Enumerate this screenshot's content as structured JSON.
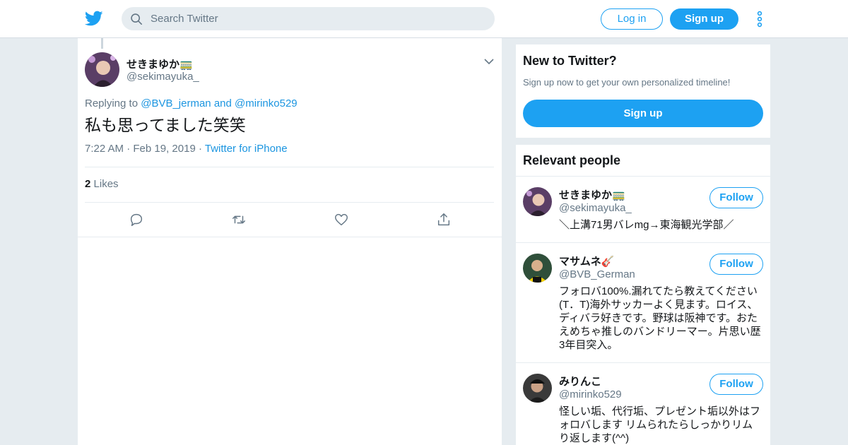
{
  "header": {
    "search_placeholder": "Search Twitter",
    "login_label": "Log in",
    "signup_label": "Sign up"
  },
  "tweet": {
    "author_name": "せきまゆか🚃",
    "author_handle": "@sekimayuka_",
    "replying_prefix": "Replying to",
    "reply_user_1": "@BVB_jerman",
    "reply_and": "and",
    "reply_user_2": "@mirinko529",
    "text": "私も思ってました笑笑",
    "time": "7:22 AM",
    "date": "Feb 19, 2019",
    "source": "Twitter for iPhone",
    "likes_count": "2",
    "likes_label": "Likes"
  },
  "sidebar": {
    "new_title": "New to Twitter?",
    "new_sub": "Sign up now to get your own personalized timeline!",
    "new_signup": "Sign up",
    "relevant_title": "Relevant people",
    "people": [
      {
        "name": "せきまゆか🚃",
        "handle": "@sekimayuka_",
        "follow": "Follow",
        "bio": "＼上溝71男バレmg→東海観光学部／"
      },
      {
        "name": "マサムネ🎸",
        "handle": "@BVB_German",
        "follow": "Follow",
        "bio": "フォロバ100%.漏れてたら教えてください(T．T)海外サッカーよく見ます。ロイス、ディバラ好きです。野球は阪神です。おたえめちゃ推しのバンドリーマー。片思い歴3年目突入。"
      },
      {
        "name": "みりんこ",
        "handle": "@mirinko529",
        "follow": "Follow",
        "bio": "怪しい垢、代行垢、プレゼント垢以外はフォロバします リムられたらしっかりリム り返します(^^)"
      }
    ]
  },
  "colors": {
    "brand_blue": "#1da1f2",
    "link_blue": "#1b95e0",
    "background": "#e6ecf0",
    "secondary_text": "#657786"
  },
  "icons": [
    "twitter-bird-icon",
    "search-icon",
    "more-vertical-icon",
    "chevron-down-icon",
    "reply-icon",
    "retweet-icon",
    "like-icon",
    "share-icon"
  ]
}
